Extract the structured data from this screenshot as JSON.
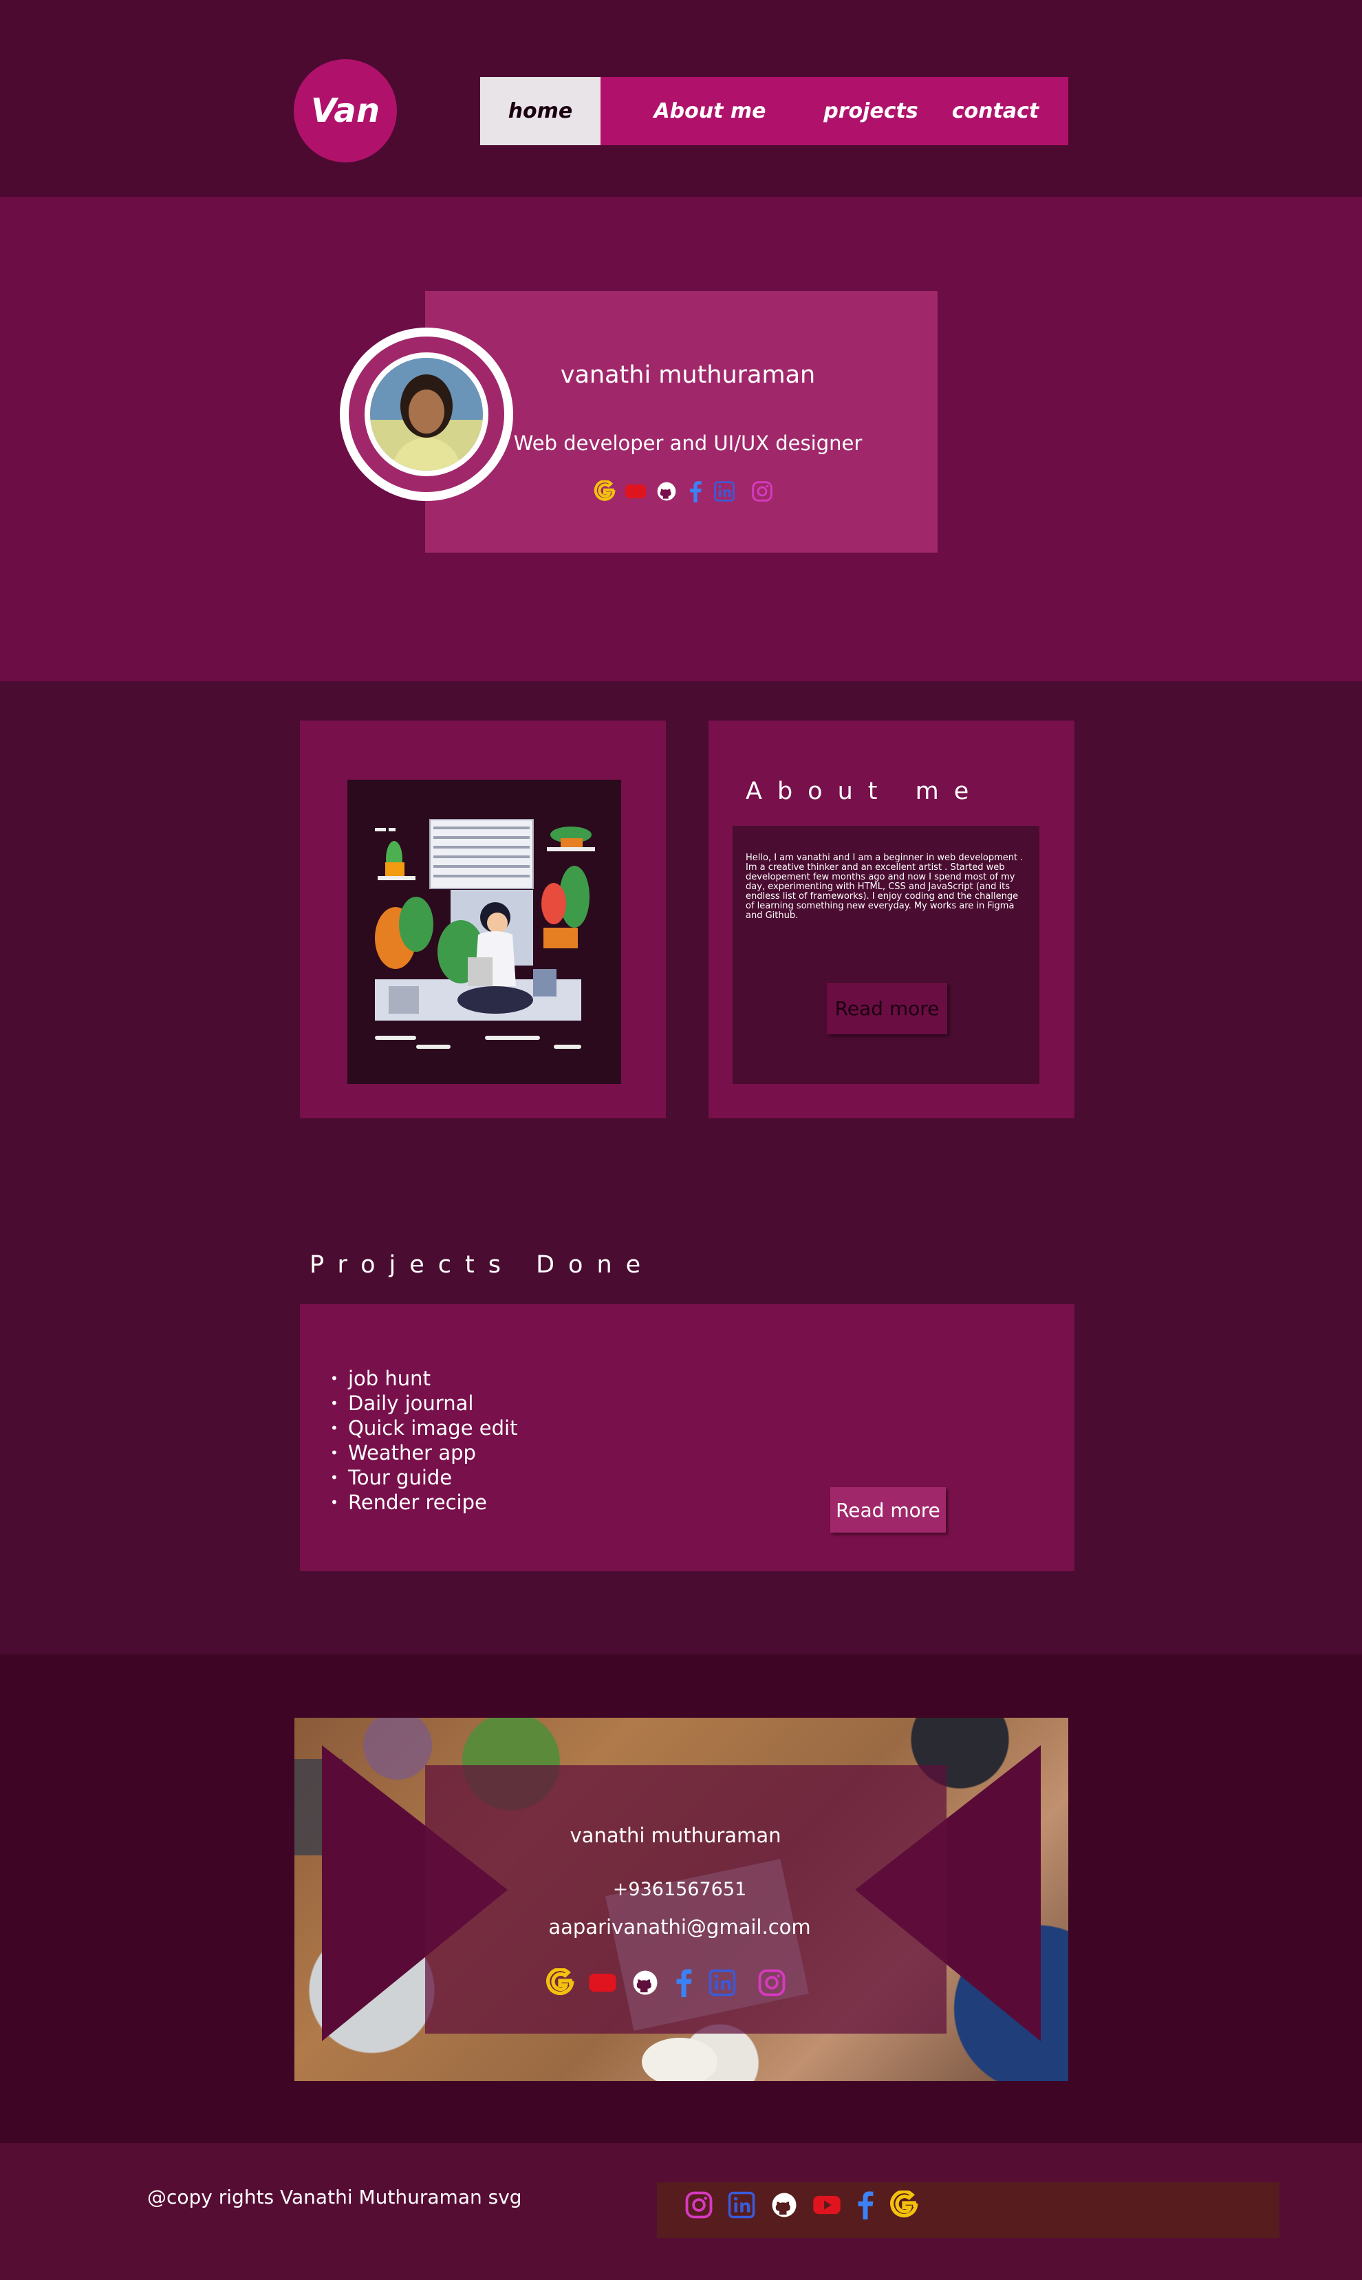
{
  "header": {
    "logo_text": "Van",
    "nav": [
      {
        "label": "home",
        "active": true
      },
      {
        "label": "About me",
        "active": false
      },
      {
        "label": "projects",
        "active": false
      },
      {
        "label": "contact",
        "active": false
      }
    ]
  },
  "hero": {
    "name": "vanathi muthuraman",
    "role": "Web developer and UI/UX designer",
    "social_icons": [
      "google-icon",
      "youtube-icon",
      "github-icon",
      "facebook-icon",
      "linkedin-icon",
      "instagram-icon"
    ]
  },
  "about": {
    "title": "About me",
    "text": "Hello, I am vanathi  and I am a  beginner in web development . Im  a creative thinker and an excellent artist . Started web developement few months ago and now I spend most of my day, experimenting with HTML, CSS and JavaScript (and its endless list of frameworks). I enjoy coding and the challenge of learning something new everyday. My works are in Figma and Github.",
    "button": "Read more"
  },
  "projects": {
    "title": "Projects Done",
    "items": [
      "job hunt",
      "Daily journal",
      "Quick image edit",
      "Weather app",
      "Tour guide",
      "Render recipe"
    ],
    "button": "Read more"
  },
  "contact": {
    "name": "vanathi muthuraman",
    "phone": "+9361567651",
    "email": "aaparivanathi@gmail.com",
    "social_icons": [
      "google-icon",
      "youtube-icon",
      "github-icon",
      "facebook-icon",
      "linkedin-icon",
      "instagram-icon"
    ]
  },
  "footer": {
    "text": "@copy rights Vanathi Muthuraman   svg",
    "social_icons": [
      "instagram-icon",
      "linkedin-icon",
      "github-icon",
      "youtube-icon",
      "facebook-icon",
      "google-icon"
    ]
  },
  "colors": {
    "accent": "#b0126b",
    "google": "#f4c20d",
    "youtube": "#e0141e",
    "github": "#ffffff",
    "facebook": "#3b82f6",
    "linkedin": "#3a5bd9",
    "instagram": "#d63abf"
  }
}
